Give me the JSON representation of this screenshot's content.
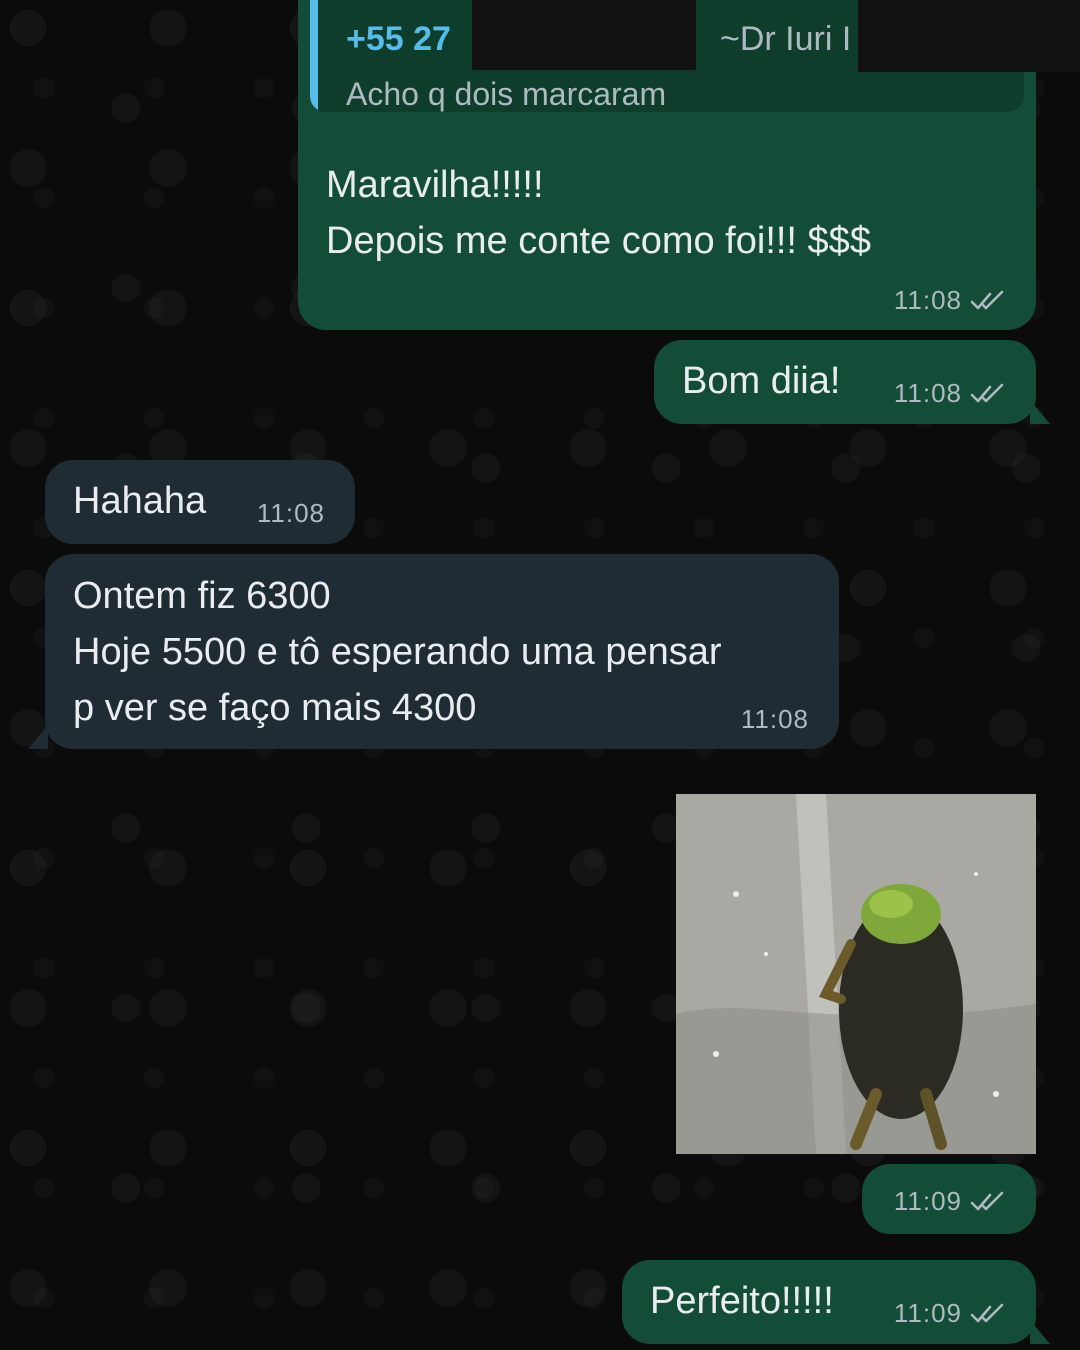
{
  "chat": {
    "messages": [
      {
        "direction": "outgoing",
        "quote": {
          "sender_number": "+55 27",
          "sender_name": "~Dr Iuri I",
          "text": "Acho q dois marcaram"
        },
        "lines": [
          "Maravilha!!!!!",
          "Depois me conte como foi!!! $$$"
        ],
        "time": "11:08",
        "status_icon": "double-check-icon"
      },
      {
        "direction": "outgoing",
        "text": "Bom diia!",
        "time": "11:08",
        "status_icon": "double-check-icon"
      },
      {
        "direction": "incoming",
        "text": "Hahaha",
        "time": "11:08"
      },
      {
        "direction": "incoming",
        "lines": [
          "Ontem fiz 6300",
          "Hoje 5500 e tô esperando uma pensar",
          "p ver se faço mais 4300"
        ],
        "time": "11:08"
      },
      {
        "direction": "outgoing",
        "media": "video-frame-frog",
        "time": "11:09",
        "status_icon": "double-check-icon"
      },
      {
        "direction": "outgoing",
        "text": "Perfeito!!!!!",
        "time": "11:09",
        "status_icon": "double-check-icon"
      }
    ]
  },
  "colors": {
    "background": "#0b0b0b",
    "outgoing_bubble": "#134d37",
    "incoming_bubble": "#202c33",
    "quote_accent": "#53bdeb",
    "meta_text": "#aebac1"
  }
}
